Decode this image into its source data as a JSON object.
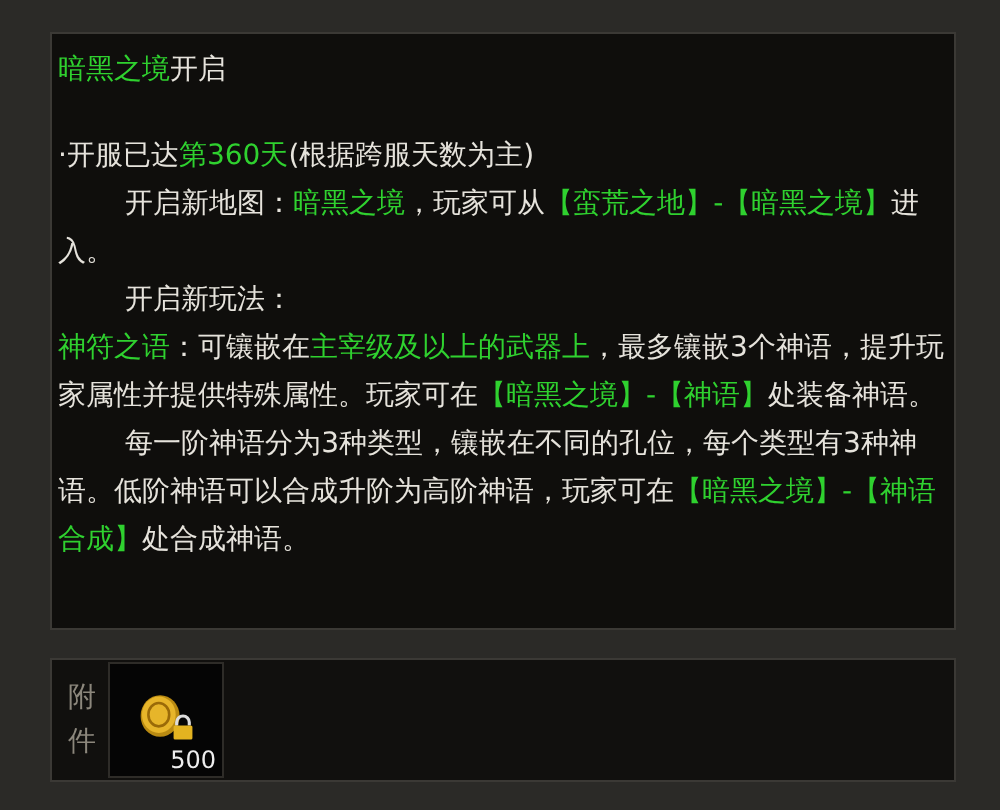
{
  "title": [
    {
      "text": "暗黑之境",
      "highlight": true
    },
    {
      "text": "开启",
      "highlight": false
    }
  ],
  "paragraphs": [
    {
      "indent": false,
      "segments": [
        {
          "text": "·开服已达",
          "highlight": false
        },
        {
          "text": "第360天",
          "highlight": true
        },
        {
          "text": "(根据跨服天数为主)",
          "highlight": false
        }
      ]
    },
    {
      "indent": true,
      "segments": [
        {
          "text": "开启新地图：",
          "highlight": false
        },
        {
          "text": "暗黑之境",
          "highlight": true
        },
        {
          "text": "，玩家可从",
          "highlight": false
        },
        {
          "text": "【蛮荒之地】-【暗黑之境】",
          "highlight": true
        },
        {
          "text": "进入。",
          "highlight": false
        }
      ]
    },
    {
      "indent": true,
      "segments": [
        {
          "text": "开启新玩法：",
          "highlight": false
        }
      ]
    },
    {
      "indent": false,
      "segments": [
        {
          "text": "神符之语",
          "highlight": true
        },
        {
          "text": "：可镶嵌在",
          "highlight": false
        },
        {
          "text": "主宰级及以上的武器上",
          "highlight": true
        },
        {
          "text": "，最多镶嵌3个神语，提升玩家属性并提供特殊属性。玩家可在",
          "highlight": false
        },
        {
          "text": "【暗黑之境】-【神语】",
          "highlight": true
        },
        {
          "text": "处装备神语。",
          "highlight": false
        }
      ]
    },
    {
      "indent": true,
      "segments": [
        {
          "text": "每一阶神语分为3种类型，镶嵌在不同的孔位，每个类型有3种神语。低阶神语可以合成升阶为高阶神语，玩家可在",
          "highlight": false
        },
        {
          "text": "【暗黑之境】-【神语合成】",
          "highlight": true
        },
        {
          "text": "处合成神语。",
          "highlight": false
        }
      ]
    }
  ],
  "attachments": {
    "label": "附件",
    "items": [
      {
        "count": "500",
        "locked": true
      }
    ]
  }
}
